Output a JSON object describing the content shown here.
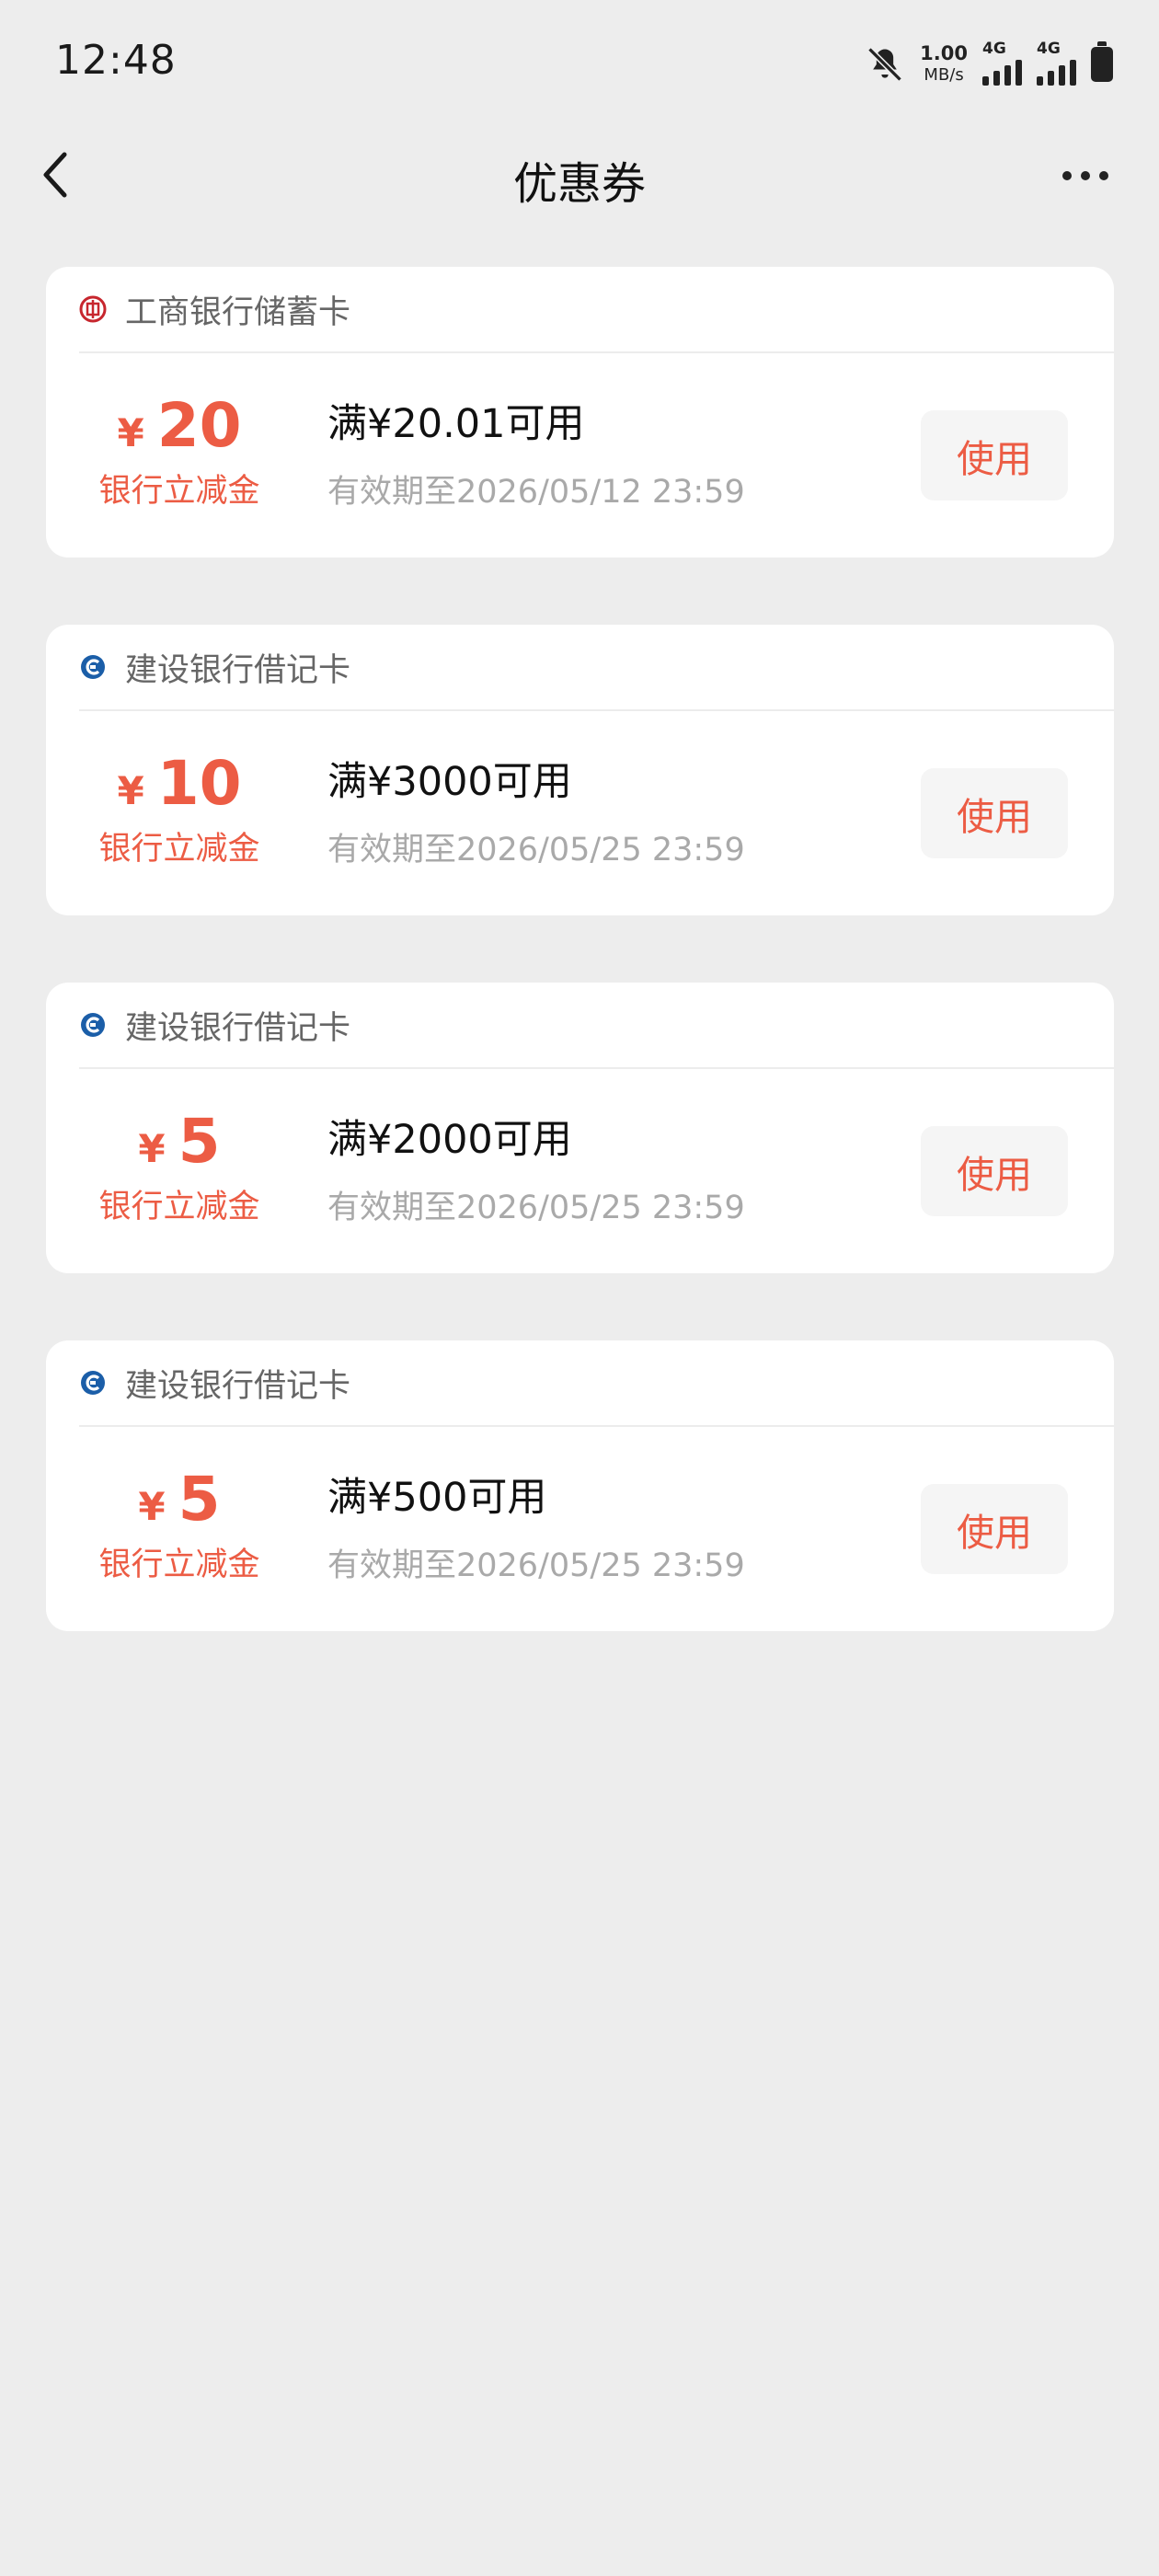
{
  "status_bar": {
    "time": "12:48",
    "net_speed_value": "1.00",
    "net_speed_unit": "MB/s",
    "sim1": "4G",
    "sim2": "4G",
    "icons": [
      "bell-muted-icon",
      "signal-icon",
      "signal-icon",
      "battery-icon"
    ]
  },
  "nav": {
    "title": "优惠券",
    "back_icon": "chevron-left-icon",
    "more_icon": "more-dots-icon"
  },
  "colors": {
    "accent": "#ec5c44",
    "icbc_red": "#c7262e",
    "ccb_blue": "#1b5ea8",
    "background": "#ededed"
  },
  "coupons": [
    {
      "bank": "工商银行储蓄卡",
      "bank_icon": "icbc-logo-icon",
      "currency": "¥",
      "amount": "20",
      "type": "银行立减金",
      "condition": "满¥20.01可用",
      "validity": "有效期至2026/05/12 23:59",
      "button": "使用"
    },
    {
      "bank": "建设银行借记卡",
      "bank_icon": "ccb-logo-icon",
      "currency": "¥",
      "amount": "10",
      "type": "银行立减金",
      "condition": "满¥3000可用",
      "validity": "有效期至2026/05/25 23:59",
      "button": "使用"
    },
    {
      "bank": "建设银行借记卡",
      "bank_icon": "ccb-logo-icon",
      "currency": "¥",
      "amount": "5",
      "type": "银行立减金",
      "condition": "满¥2000可用",
      "validity": "有效期至2026/05/25 23:59",
      "button": "使用"
    },
    {
      "bank": "建设银行借记卡",
      "bank_icon": "ccb-logo-icon",
      "currency": "¥",
      "amount": "5",
      "type": "银行立减金",
      "condition": "满¥500可用",
      "validity": "有效期至2026/05/25 23:59",
      "button": "使用"
    }
  ]
}
